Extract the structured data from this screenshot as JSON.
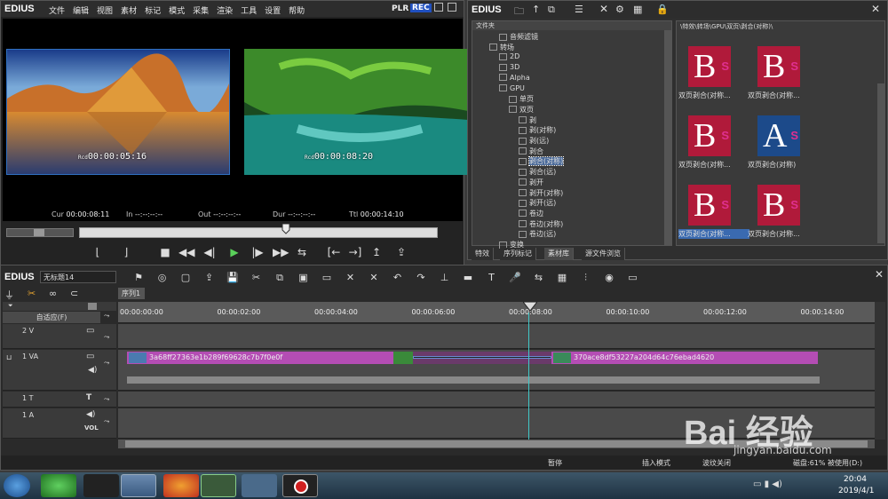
{
  "player": {
    "app_name": "EDIUS",
    "menu": [
      "文件",
      "编辑",
      "视图",
      "素材",
      "标记",
      "模式",
      "采集",
      "渲染",
      "工具",
      "设置",
      "帮助"
    ],
    "mode_plr": "PLR",
    "mode_rec": "REC",
    "left_tc": "00:00:05:16",
    "left_tc_prefix": "Rcd",
    "right_tc": "00:00:08:20",
    "right_tc_prefix": "Rcd",
    "cur_label": "Cur",
    "cur_value": "00:00:08:11",
    "in_label": "In",
    "in_value": "--:--:--:--",
    "out_label": "Out",
    "out_value": "--:--:--:--",
    "dur_label": "Dur",
    "dur_value": "--:--:--:--",
    "ttl_label": "Ttl",
    "ttl_value": "00:00:14:10",
    "playhead_fraction": 0.58
  },
  "bin": {
    "app_name": "EDIUS",
    "folder_label": "文件夹",
    "path": "\\特效\\转场\\GPU\\双页\\剥合(对称)\\",
    "tree": [
      {
        "label": "音频滤镜",
        "indent": 2
      },
      {
        "label": "转场",
        "indent": 1
      },
      {
        "label": "2D",
        "indent": 2
      },
      {
        "label": "3D",
        "indent": 2
      },
      {
        "label": "Alpha",
        "indent": 2
      },
      {
        "label": "GPU",
        "indent": 2
      },
      {
        "label": "单页",
        "indent": 3
      },
      {
        "label": "双页",
        "indent": 3
      },
      {
        "label": "剥",
        "indent": 4
      },
      {
        "label": "剥(对称)",
        "indent": 4
      },
      {
        "label": "剥(远)",
        "indent": 4
      },
      {
        "label": "剥合",
        "indent": 4
      },
      {
        "label": "剥合(对称)",
        "indent": 4,
        "selected": true
      },
      {
        "label": "剥合(远)",
        "indent": 4
      },
      {
        "label": "剥开",
        "indent": 4
      },
      {
        "label": "剥开(对称)",
        "indent": 4
      },
      {
        "label": "剥开(远)",
        "indent": 4
      },
      {
        "label": "卷边",
        "indent": 4
      },
      {
        "label": "卷边(对称)",
        "indent": 4
      },
      {
        "label": "卷边(远)",
        "indent": 4
      },
      {
        "label": "变换",
        "indent": 2
      }
    ],
    "effects": [
      {
        "letter": "B",
        "badge": "S",
        "name": "双页剥合(对称...",
        "color": "red"
      },
      {
        "letter": "B",
        "badge": "S",
        "name": "双页剥合(对称...",
        "color": "red"
      },
      {
        "letter": "B",
        "badge": "S",
        "name": "双页剥合(对称...",
        "color": "red"
      },
      {
        "letter": "A",
        "badge": "S",
        "name": "双页剥合(对称)",
        "color": "blue"
      },
      {
        "letter": "B",
        "badge": "S",
        "name": "双页剥合(对称...",
        "color": "red",
        "selected": true
      },
      {
        "letter": "B",
        "badge": "S",
        "name": "双页剥合(对称...",
        "color": "red"
      }
    ],
    "tabs": [
      "特效",
      "序列标记",
      "素材库",
      "源文件浏览"
    ]
  },
  "timeline": {
    "app_name": "EDIUS",
    "project": "无标题14",
    "sequence_tab": "序列1",
    "mode_dropdown": "自适应(F)",
    "ruler": [
      "00:00:00:00",
      "00:00:02:00",
      "00:00:04:00",
      "00:00:06:00",
      "00:00:08:00",
      "00:00:10:00",
      "00:00:12:00",
      "00:00:14:00"
    ],
    "tracks": [
      {
        "name": "2 V"
      },
      {
        "name": "1 VA"
      },
      {
        "name": "1 T"
      },
      {
        "name": "1 A"
      }
    ],
    "vol_label": "VOL",
    "clip1": "3a68ff27363e1b289f69628c7b7f0e0f",
    "clip2": "370ace8df53227a204d64c76ebad4620",
    "status": {
      "pause": "暂停",
      "insert": "插入模式",
      "ripple": "波纹关闭",
      "disk": "磁盘:61% 被使用(D:)"
    }
  },
  "taskbar": {
    "time": "20:04",
    "date": "2019/4/1"
  },
  "watermark": {
    "brand": "Bai 经验",
    "url": "jingyan.baidu.com"
  }
}
